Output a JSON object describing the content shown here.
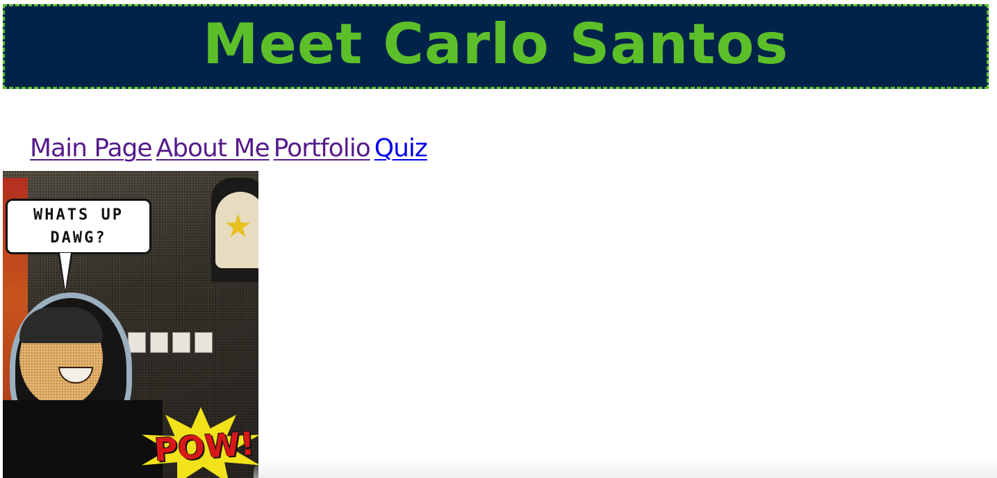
{
  "header": {
    "title": "Meet Carlo Santos"
  },
  "nav": {
    "items": [
      {
        "label": "Main Page",
        "state": "visited"
      },
      {
        "label": "About Me",
        "state": "visited"
      },
      {
        "label": "Portfolio",
        "state": "visited"
      },
      {
        "label": "Quiz",
        "state": "unvisited"
      }
    ]
  },
  "photo": {
    "bubble_line1": "WHATS UP",
    "bubble_line2": "DAWG?",
    "burst_text": "POW!"
  },
  "colors": {
    "banner_bg": "#00234a",
    "banner_text": "#5cbf2a",
    "link_visited": "#551a8b",
    "link_unvisited": "#0000ee"
  }
}
